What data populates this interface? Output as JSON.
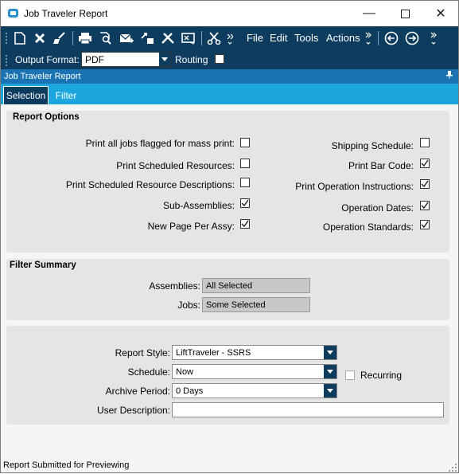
{
  "window": {
    "title": "Job Traveler Report",
    "minimize_glyph": "—",
    "maximize_glyph": "☐",
    "close_glyph": "✕"
  },
  "toolbar": {
    "icons": [
      "new-document-icon",
      "delete-icon",
      "clear-icon",
      "print-icon",
      "print-preview-icon",
      "submit-icon",
      "schedule-icon",
      "tools-icon",
      "report-style-icon",
      "cut-icon",
      "overflow-icon",
      "back-icon",
      "forward-icon"
    ],
    "menus": {
      "file": "File",
      "edit": "Edit",
      "tools": "Tools",
      "actions": "Actions"
    }
  },
  "options_bar": {
    "output_format_label": "Output Format:",
    "output_format_value": "PDF",
    "routing_label": "Routing",
    "routing_checked": false
  },
  "sheet": {
    "title": "Job Traveler Report"
  },
  "tabs": {
    "selection": "Selection",
    "filter": "Filter",
    "active": "selection"
  },
  "report_options": {
    "title": "Report Options",
    "left": [
      {
        "label": "Print all jobs flagged for mass print:",
        "checked": false
      },
      {
        "label": "Print Scheduled Resources:",
        "checked": false
      },
      {
        "label": "Print Scheduled Resource Descriptions:",
        "checked": false
      },
      {
        "label": "Sub-Assemblies:",
        "checked": true
      },
      {
        "label": "New Page Per Assy:",
        "checked": true
      }
    ],
    "right": [
      {
        "label": "Shipping Schedule:",
        "checked": false
      },
      {
        "label": "Print Bar Code:",
        "checked": true
      },
      {
        "label": "Print Operation Instructions:",
        "checked": true
      },
      {
        "label": "Operation Dates:",
        "checked": true
      },
      {
        "label": "Operation Standards:",
        "checked": true
      }
    ]
  },
  "filter_summary": {
    "title": "Filter Summary",
    "assemblies_label": "Assemblies:",
    "assemblies_value": "All Selected",
    "jobs_label": "Jobs:",
    "jobs_value": "Some Selected"
  },
  "report": {
    "style_label": "Report Style:",
    "style_value": "LiftTraveler - SSRS",
    "schedule_label": "Schedule:",
    "schedule_value": "Now",
    "recurring_label": "Recurring",
    "recurring_checked": false,
    "archive_label": "Archive Period:",
    "archive_value": "0 Days",
    "user_desc_label": "User Description:",
    "user_desc_value": ""
  },
  "status": {
    "text": "Report Submitted for Previewing"
  },
  "colors": {
    "dark_navy": "#0d3c5f",
    "sheet_blue": "#1a74b4",
    "tab_blue": "#1ba6dd",
    "group_bg": "#e5e5e5"
  }
}
